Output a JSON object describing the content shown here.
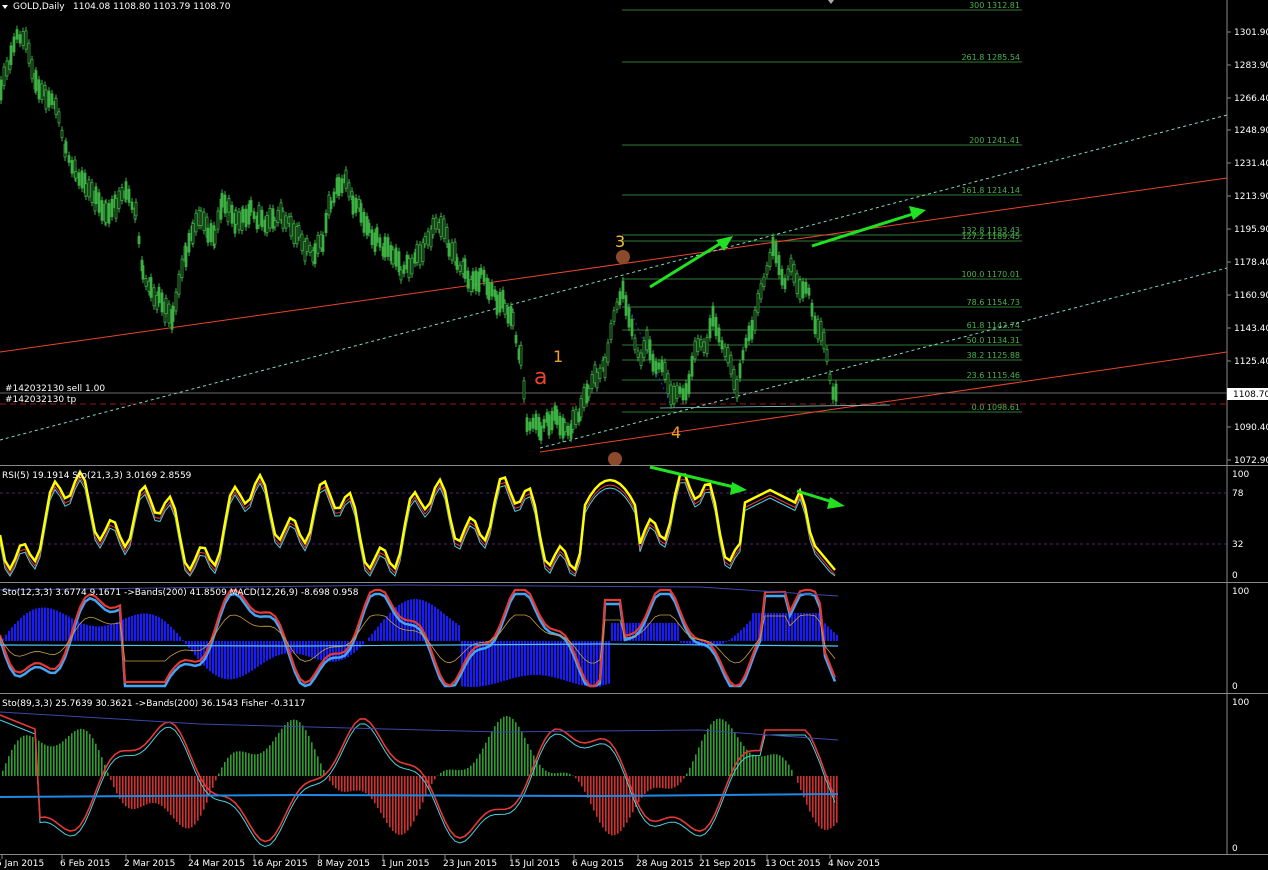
{
  "header": {
    "symbol_label": "GOLD,Daily",
    "ohlc": "1104.08 1108.80 1103.79 1108.70"
  },
  "price_axis": {
    "ticks": [
      "1301.90",
      "1283.90",
      "1266.40",
      "1248.90",
      "1231.40",
      "1213.90",
      "1195.90",
      "1178.40",
      "1160.90",
      "1143.40",
      "1125.40",
      "1108.70",
      "1090.40",
      "1072.90"
    ],
    "current_price": "1108.70"
  },
  "time_axis": {
    "ticks": [
      "5 Jan 2015",
      "6 Feb 2015",
      "2 Mar 2015",
      "24 Mar 2015",
      "16 Apr 2015",
      "8 May 2015",
      "1 Jun 2015",
      "23 Jun 2015",
      "15 Jul 2015",
      "6 Aug 2015",
      "28 Aug 2015",
      "21 Sep 2015",
      "13 Oct 2015",
      "4 Nov 2015"
    ]
  },
  "order_labels": {
    "sell": "#142032130 sell 1.00",
    "tp": "#142032130 tp"
  },
  "fibonacci_levels": [
    {
      "label": "300 1312.81"
    },
    {
      "label": "261.8 1285.54"
    },
    {
      "label": "200 1241.41"
    },
    {
      "label": "161.8 1214.14"
    },
    {
      "label": "132.8 1193.43"
    },
    {
      "label": "127.2 1189.45"
    },
    {
      "label": "100.0 1170.01"
    },
    {
      "label": "78.6 1154.73"
    },
    {
      "label": "61.8 1142.74"
    },
    {
      "label": "50.0 1134.31"
    },
    {
      "label": "38.2 1125.88"
    },
    {
      "label": "23.6 1115.46"
    },
    {
      "label": "0.0 1098.61"
    }
  ],
  "wave_labels": {
    "a": "a",
    "w1": "1",
    "w3": "3",
    "w4": "4"
  },
  "panels": {
    "rsi": {
      "label": "RSI(5) 19.1914  Sto(21,3,3) 3.0169 2.8559",
      "ticks": [
        "100",
        "78",
        "32",
        "0"
      ]
    },
    "macd": {
      "label": "Sto(12,3,3) 3.6774 9.1671  ->Bands(200) 41.8509  MACD(12,26,9) -8.698 0.958",
      "ticks": [
        "100",
        "0"
      ]
    },
    "fisher": {
      "label": "Sto(89,3,3) 25.7639 30.3621  ->Bands(200) 36.1543  Fisher -0.3117",
      "ticks": [
        "100",
        "0"
      ]
    }
  },
  "colors": {
    "background": "#000000",
    "candle": "#3cb043",
    "fib": "#2e7d32",
    "channel_red": "#e8452c",
    "channel_cyan": "#7fd8c8",
    "arrow": "#22e022",
    "rsi": "#ffff00",
    "wave_marker": "#8b4a2b"
  }
}
